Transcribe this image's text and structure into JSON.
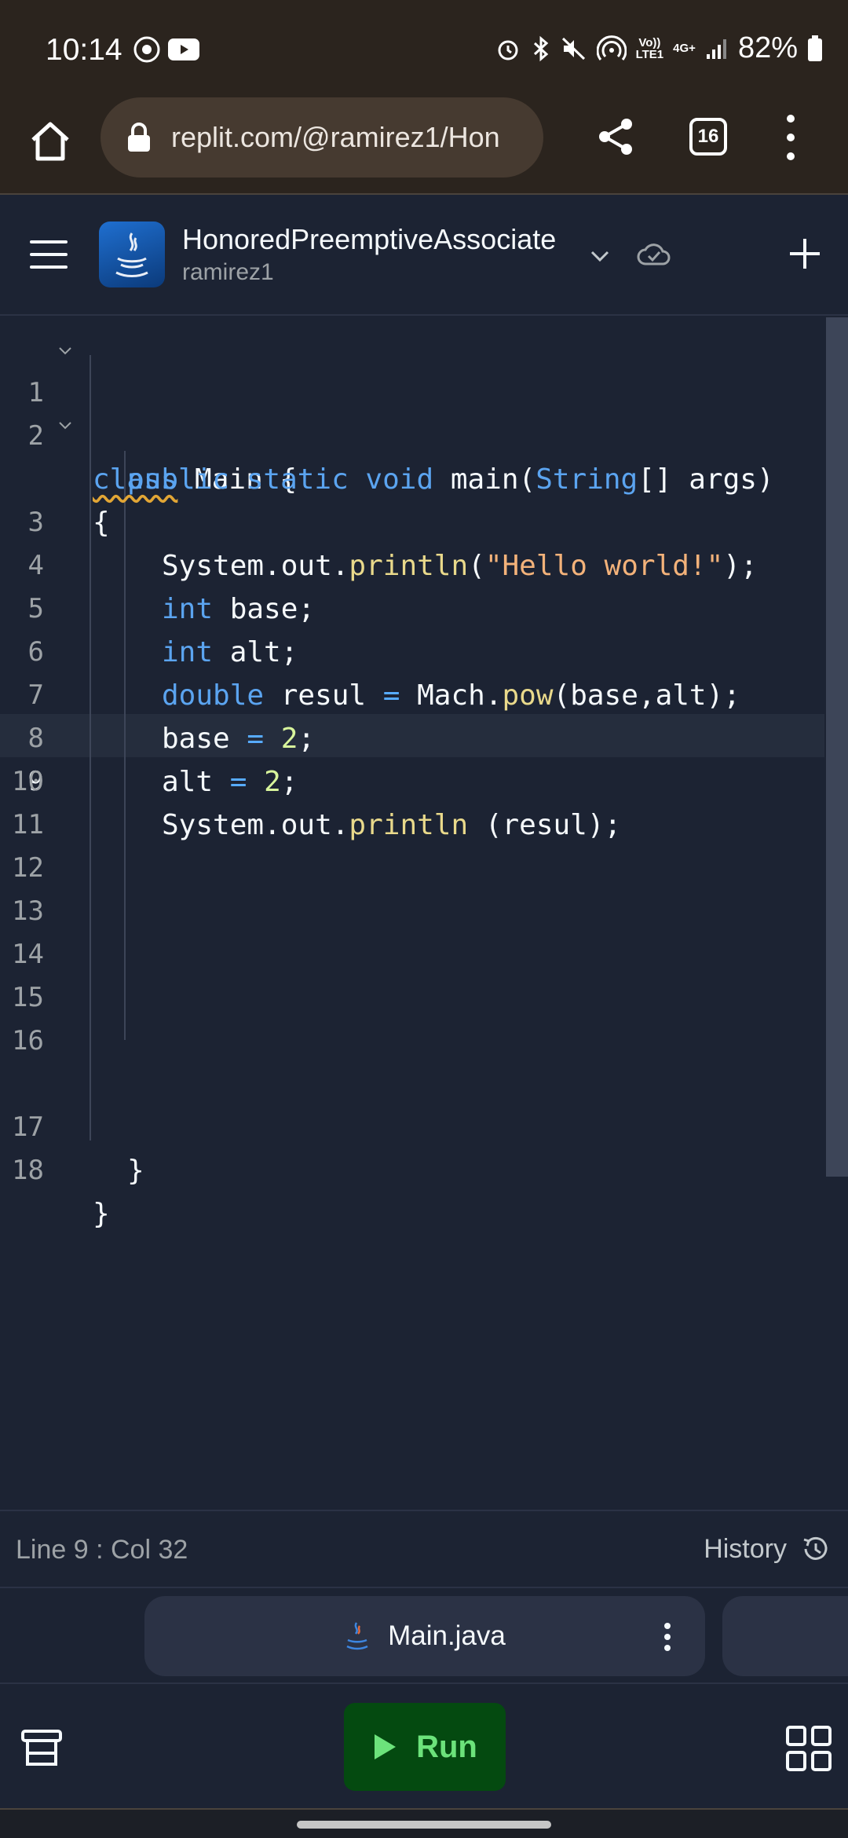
{
  "status_bar": {
    "time": "10:14",
    "battery": "82%",
    "network_top": "Vo))",
    "network_bottom": "LTE1",
    "network_type": "4G+"
  },
  "browser": {
    "url": "replit.com/@ramirez1/Hon",
    "tab_count": "16"
  },
  "repl": {
    "name": "HonoredPreemptiveAssociate",
    "owner": "ramirez1"
  },
  "editor": {
    "line_numbers": [
      "1",
      "2",
      "",
      "3",
      "4",
      "5",
      "6",
      "7",
      "8",
      "9",
      "10",
      "11",
      "12",
      "13",
      "14",
      "15",
      "16",
      "17",
      "18"
    ],
    "active_line": "9",
    "code": {
      "l1_kw": "class",
      "l1_rest": " Main {",
      "l2_kw1": "public static void",
      "l2_fn": " main(",
      "l2_type": "String",
      "l2_rest": "[] args)",
      "l2b": "{",
      "l3_obj": "System.out.",
      "l3_fn": "println",
      "l3_open": "(",
      "l3_str": "\"Hello world!\"",
      "l3_close": ");",
      "l4_kw": "int",
      "l4_rest": " base;",
      "l5_kw": "int",
      "l5_rest": " alt;",
      "l6_kw": "double",
      "l6_a": " resul ",
      "l6_eq": "=",
      "l6_b": " Mach.",
      "l6_fn": "pow",
      "l6_c": "(base,alt);",
      "l7_a": "base ",
      "l7_eq": "=",
      "l7_num": " 2",
      "l7_end": ";",
      "l8_a": "alt ",
      "l8_eq": "=",
      "l8_num": " 2",
      "l8_end": ";",
      "l9_obj": "System.out.",
      "l9_fn": "println",
      "l9_rest": " (resul);",
      "l17": "}",
      "l18": "}"
    }
  },
  "status_row": {
    "position": "Line 9 : Col 32",
    "history_label": "History"
  },
  "file_tab": {
    "label": "Main.java"
  },
  "toolbar": {
    "run_label": "Run"
  },
  "icons": {
    "home": "home-icon",
    "lock": "lock-icon",
    "share": "share-icon",
    "menu": "hamburger-icon",
    "java": "java-icon",
    "chevron": "chevron-down-icon",
    "cloud": "cloud-check-icon",
    "plus": "plus-icon",
    "history": "history-icon",
    "run": "play-icon",
    "tools": "layers-icon",
    "grid": "grid-icon"
  },
  "colors": {
    "keyword": "#5ba4f0",
    "function": "#e9d98b",
    "string": "#f3b27a",
    "number": "#d8f59c",
    "run_bg": "#044a10",
    "run_text": "#6ce37b"
  }
}
